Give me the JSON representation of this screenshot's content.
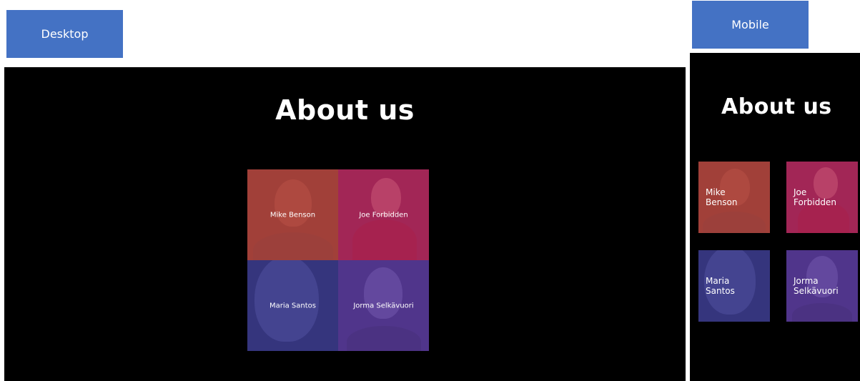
{
  "labels": {
    "desktop": "Desktop",
    "mobile": "Mobile"
  },
  "desktop": {
    "title": "About us",
    "team": [
      {
        "name": "Mike Benson"
      },
      {
        "name": "Joe Forbidden"
      },
      {
        "name": "Maria Santos"
      },
      {
        "name": "Jorma Selkävuori"
      }
    ]
  },
  "mobile": {
    "title": "About us",
    "team": [
      {
        "name_line1": "Mike",
        "name_line2": "Benson"
      },
      {
        "name_line1": "Joe",
        "name_line2": "Forbidden"
      },
      {
        "name_line1": "Maria",
        "name_line2": "Santos"
      },
      {
        "name_line1": "Jorma",
        "name_line2": "Selkävuori"
      }
    ]
  },
  "colors": {
    "label_blue": "#4472c4",
    "frame_bg": "#000000",
    "tint_red": "#b5423e",
    "tint_pink": "#b1265c",
    "tint_blue": "#3b3a8c",
    "tint_purple": "#5a3a9a"
  }
}
